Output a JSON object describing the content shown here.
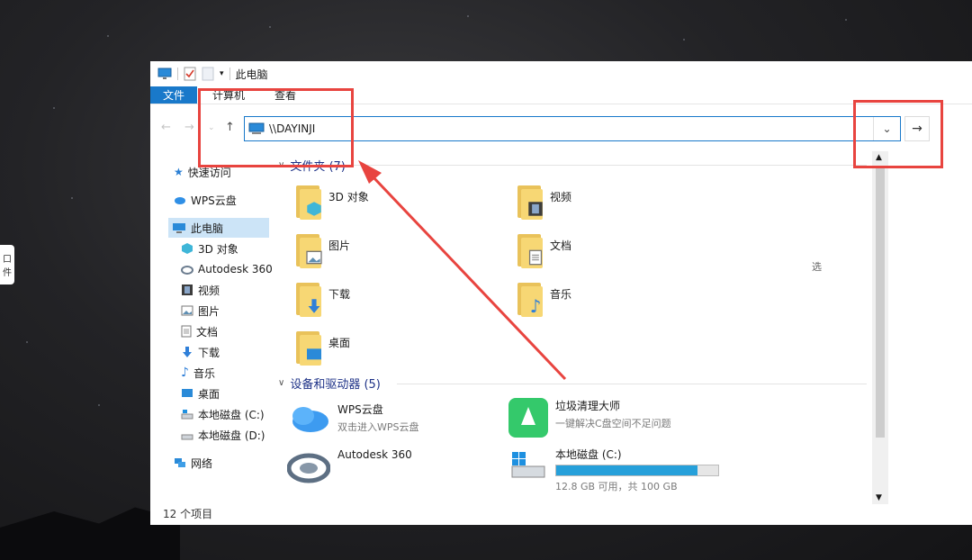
{
  "window": {
    "title": "此电脑",
    "ribbon_tabs": [
      "文件",
      "计算机",
      "查看"
    ]
  },
  "address": {
    "path": "\\\\DAYINJI"
  },
  "sidebar": {
    "items": [
      {
        "label": "快速访问",
        "icon": "star-icon"
      },
      {
        "label": "WPS云盘",
        "icon": "cloud-icon"
      },
      {
        "label": "此电脑",
        "icon": "computer-icon"
      },
      {
        "label": "3D 对象",
        "icon": "cube-icon"
      },
      {
        "label": "Autodesk 360",
        "icon": "autodesk-icon"
      },
      {
        "label": "视频",
        "icon": "video-icon"
      },
      {
        "label": "图片",
        "icon": "picture-icon"
      },
      {
        "label": "文档",
        "icon": "document-icon"
      },
      {
        "label": "下载",
        "icon": "download-icon"
      },
      {
        "label": "音乐",
        "icon": "music-icon"
      },
      {
        "label": "桌面",
        "icon": "desktop-icon"
      },
      {
        "label": "本地磁盘 (C:)",
        "icon": "drive-icon"
      },
      {
        "label": "本地磁盘 (D:)",
        "icon": "drive-icon"
      },
      {
        "label": "网络",
        "icon": "network-icon"
      }
    ]
  },
  "folders_group": {
    "header": "文件夹 (7)",
    "items": [
      {
        "label": "3D 对象",
        "icon": "cube-icon"
      },
      {
        "label": "视频",
        "icon": "video-icon"
      },
      {
        "label": "图片",
        "icon": "picture-icon"
      },
      {
        "label": "文档",
        "icon": "document-icon"
      },
      {
        "label": "下载",
        "icon": "download-icon"
      },
      {
        "label": "音乐",
        "icon": "music-icon"
      },
      {
        "label": "桌面",
        "icon": "desktop-icon"
      }
    ]
  },
  "devices_group": {
    "header": "设备和驱动器 (5)",
    "items": [
      {
        "name": "WPS云盘",
        "sub": "双击进入WPS云盘",
        "icon": "cloud-icon"
      },
      {
        "name": "垃圾清理大师",
        "sub": "一键解决C盘空间不足问题",
        "icon": "broom-icon"
      },
      {
        "name": "Autodesk 360",
        "sub": "",
        "icon": "autodesk-icon"
      },
      {
        "name": "本地磁盘 (C:)",
        "sub": "12.8 GB 可用，共 100 GB",
        "icon": "drive-icon",
        "used_fraction": 0.872
      }
    ]
  },
  "status": {
    "item_count": "12 个项目"
  },
  "right_pane": {
    "partial_text": "选"
  },
  "side_widget": {
    "line1": "口",
    "line2": "件"
  },
  "colors": {
    "accent": "#1979ca",
    "highlight_annotation": "#e8443f",
    "folder": "#f7d774",
    "progress": "#26a0da"
  }
}
